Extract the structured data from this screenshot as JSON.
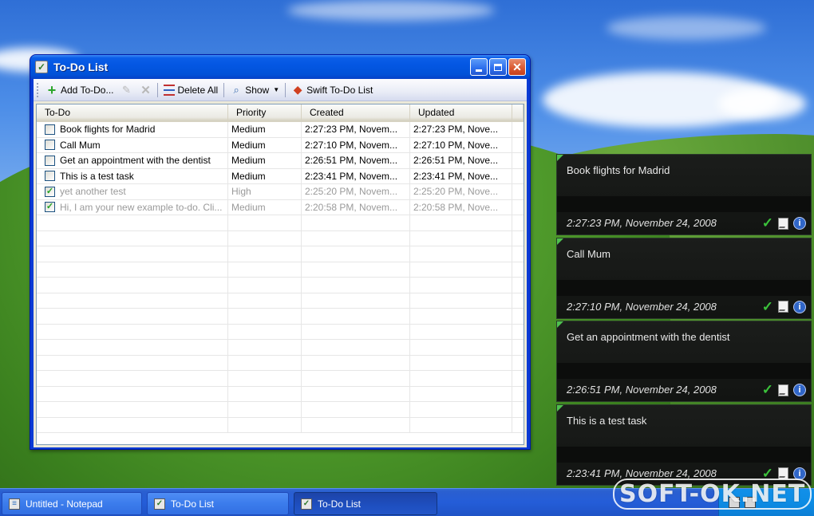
{
  "window": {
    "title": "To-Do List"
  },
  "toolbar": {
    "add_label": "Add To-Do...",
    "delete_all_label": "Delete All",
    "show_label": "Show",
    "swift_label": "Swift To-Do List"
  },
  "columns": [
    "To-Do",
    "Priority",
    "Created",
    "Updated"
  ],
  "rows": [
    {
      "todo": "Book flights for Madrid",
      "priority": "Medium",
      "created": "2:27:23 PM, Novem...",
      "updated": "2:27:23 PM, Nove...",
      "done": false
    },
    {
      "todo": "Call Mum",
      "priority": "Medium",
      "created": "2:27:10 PM, Novem...",
      "updated": "2:27:10 PM, Nove...",
      "done": false
    },
    {
      "todo": "Get an appointment with the dentist",
      "priority": "Medium",
      "created": "2:26:51 PM, Novem...",
      "updated": "2:26:51 PM, Nove...",
      "done": false
    },
    {
      "todo": "This is a test task",
      "priority": "Medium",
      "created": "2:23:41 PM, Novem...",
      "updated": "2:23:41 PM, Nove...",
      "done": false
    },
    {
      "todo": "yet another test",
      "priority": "High",
      "created": "2:25:20 PM, Novem...",
      "updated": "2:25:20 PM, Nove...",
      "done": true
    },
    {
      "todo": "Hi, I am your new example to-do. Cli...",
      "priority": "Medium",
      "created": "2:20:58 PM, Novem...",
      "updated": "2:20:58 PM, Nove...",
      "done": true
    }
  ],
  "gadget_notes": [
    {
      "title": "Book flights for Madrid",
      "date": "2:27:23 PM, November 24, 2008"
    },
    {
      "title": "Call Mum",
      "date": "2:27:10 PM, November 24, 2008"
    },
    {
      "title": "Get an appointment with the dentist",
      "date": "2:26:51 PM, November 24, 2008"
    },
    {
      "title": "This is a test task",
      "date": "2:23:41 PM, November 24, 2008"
    }
  ],
  "taskbar": {
    "items": [
      "Untitled - Notepad",
      "To-Do List",
      "To-Do List"
    ]
  },
  "watermark": "SOFT-OK.NET",
  "colors": {
    "titlebar": "#0457e3",
    "check_green": "#3bc23b",
    "taskbar": "#245dd8"
  }
}
